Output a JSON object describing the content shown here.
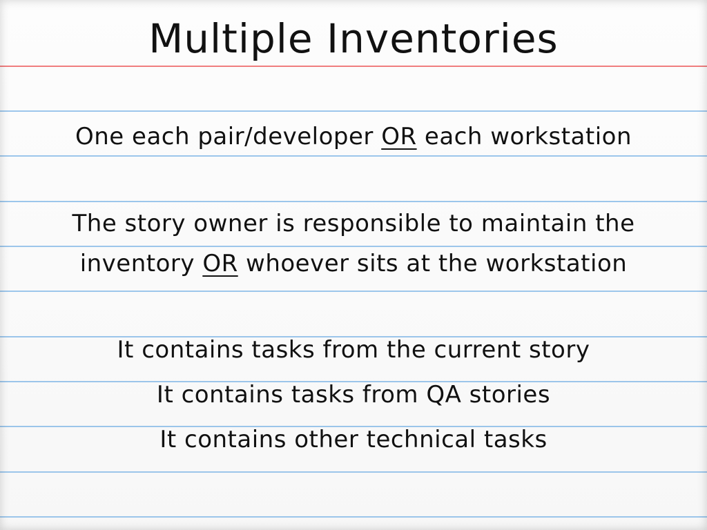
{
  "slide": {
    "title": "Multiple Inventories",
    "blocks": [
      {
        "lines": [
          {
            "pre": "One each pair/developer ",
            "em": "OR",
            "post": " each workstation"
          }
        ]
      },
      {
        "lines": [
          {
            "pre": "The story owner is responsible to maintain the",
            "em": "",
            "post": ""
          },
          {
            "pre": "inventory ",
            "em": "OR",
            "post": " whoever sits at the workstation"
          }
        ]
      },
      {
        "lines": [
          {
            "pre": "It contains tasks from the current story",
            "em": "",
            "post": ""
          },
          {
            "pre": "It contains tasks from QA stories",
            "em": "",
            "post": ""
          },
          {
            "pre": "It contains other technical tasks",
            "em": "",
            "post": ""
          }
        ]
      }
    ]
  },
  "colors": {
    "background": "#fdfdfd",
    "rule_blue": "#8bbce8",
    "rule_red": "#ee6f70",
    "text": "#111111"
  }
}
